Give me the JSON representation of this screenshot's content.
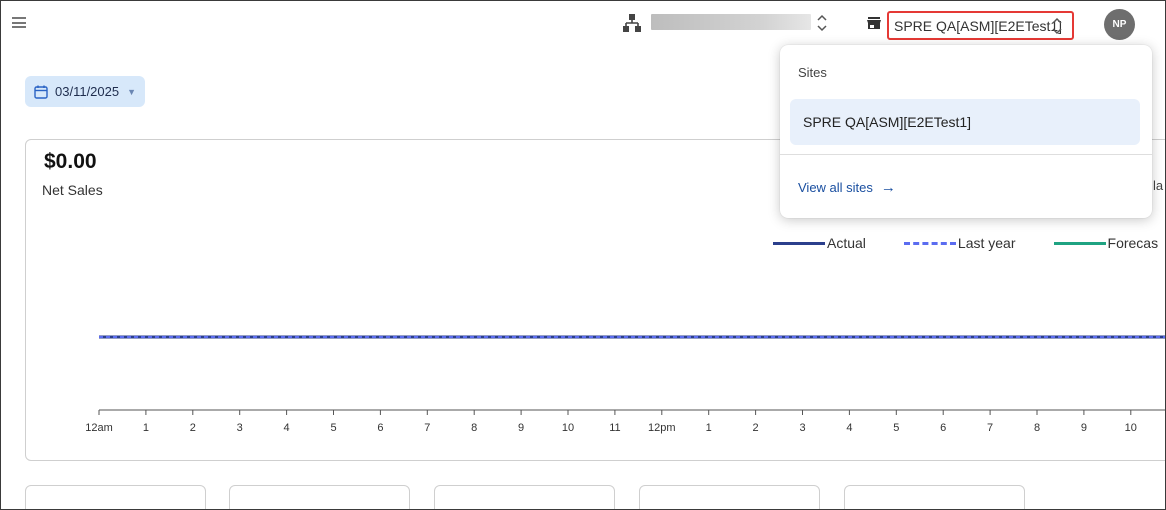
{
  "header": {
    "menu_icon": "hamburger-menu-icon",
    "org_icon": "org-hierarchy-icon",
    "store_icon": "store-icon",
    "site_selector_label": "SPRE QA[ASM][E2ETest1]",
    "avatar_initials": "NP"
  },
  "date_filter": {
    "value": "03/11/2025"
  },
  "sales_card": {
    "amount": "$0.00",
    "label": "Net Sales",
    "partial_text": "la",
    "legend": [
      {
        "name": "Actual",
        "color": "#2b3f8c",
        "style": "solid"
      },
      {
        "name": "Last year",
        "color": "#5b6cf0",
        "style": "dashed"
      },
      {
        "name": "Forecas",
        "color": "#1fa382",
        "style": "solid"
      }
    ]
  },
  "chart_data": {
    "type": "line",
    "x": [
      "12am",
      "1",
      "2",
      "3",
      "4",
      "5",
      "6",
      "7",
      "8",
      "9",
      "10",
      "11",
      "12pm",
      "1",
      "2",
      "3",
      "4",
      "5",
      "6",
      "7",
      "8",
      "9",
      "10"
    ],
    "series": [
      {
        "name": "Actual",
        "values": [
          0,
          0,
          0,
          0,
          0,
          0,
          0,
          0,
          0,
          0,
          0,
          0,
          0,
          0,
          0,
          0,
          0,
          0,
          0,
          0,
          0,
          0,
          0
        ]
      },
      {
        "name": "Last year",
        "values": [
          0,
          0,
          0,
          0,
          0,
          0,
          0,
          0,
          0,
          0,
          0,
          0,
          0,
          0,
          0,
          0,
          0,
          0,
          0,
          0,
          0,
          0,
          0
        ]
      }
    ],
    "title": "",
    "xlabel": "",
    "ylabel": ""
  },
  "site_dropdown": {
    "header": "Sites",
    "options": [
      "SPRE QA[ASM][E2ETest1]"
    ],
    "view_all_label": "View all sites",
    "arrow_icon": "arrow-right-icon"
  },
  "colors": {
    "accent": "#1a4fa0",
    "chip_bg": "#d7e8fa",
    "highlight_border": "#e53935",
    "option_bg": "#e8f0fb"
  }
}
